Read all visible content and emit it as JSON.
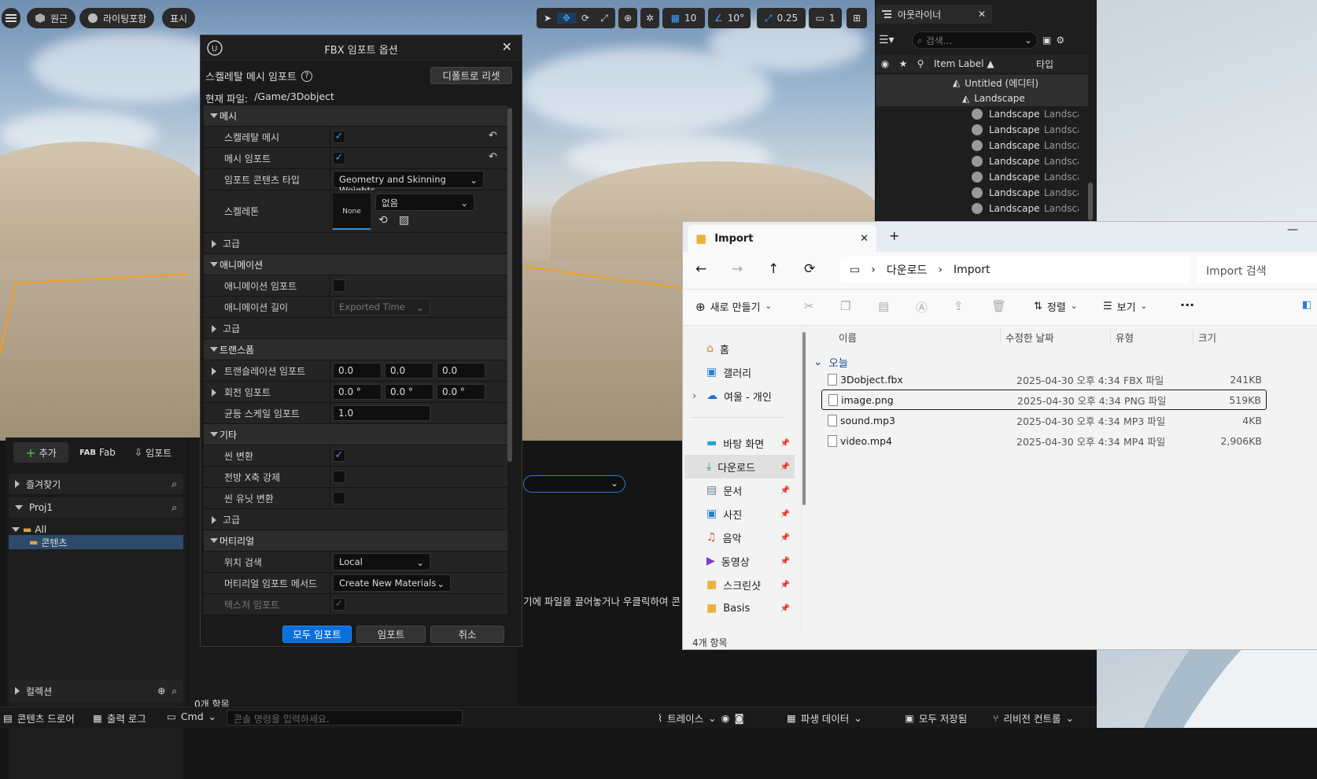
{
  "viewport": {
    "perspective_label": "원근",
    "lighting_label": "라이팅포함",
    "show_label": "표시",
    "grid_snap": "10",
    "rotation_snap": "10°",
    "scale_snap": "0.25",
    "camera_speed": "1"
  },
  "outliner": {
    "tab_title": "아웃라이너",
    "search_placeholder": "검색...",
    "col_label": "Item Label ▲",
    "col_type": "타입",
    "root": "Untitled (에디터)",
    "landscape": "Landscape",
    "children": [
      {
        "label": "Landscape",
        "type": "Landsca"
      },
      {
        "label": "Landscape",
        "type": "Landsca"
      },
      {
        "label": "Landscape",
        "type": "Landsca"
      },
      {
        "label": "Landscape",
        "type": "Landsca"
      },
      {
        "label": "Landscape",
        "type": "Landsca"
      },
      {
        "label": "Landscape",
        "type": "Landsca"
      },
      {
        "label": "Landscape",
        "type": "Landsca"
      }
    ]
  },
  "fbx": {
    "title": "FBX 임포트 옵션",
    "section_header": "스켈레탈 메시 임포트",
    "reset_button": "디폴트로 리셋",
    "current_file_label": "현재 파일:",
    "current_file_value": "/Game/3Dobject",
    "mesh_section": "메시",
    "skeletal_mesh_label": "스켈레탈 메시",
    "mesh_import_label": "메시 임포트",
    "content_type_label": "임포트 콘텐츠 타입",
    "content_type_value": "Geometry and Skinning Weights",
    "skeleton_label": "스켈레톤",
    "skeleton_thumb": "None",
    "skeleton_value": "없음",
    "advanced": "고급",
    "animation_section": "애니메이션",
    "anim_import_label": "애니메이션 임포트",
    "anim_length_label": "애니메이션 길이",
    "anim_length_value": "Exported Time",
    "transform_section": "트랜스폼",
    "translation_label": "트랜슬레이션 임포트",
    "translation": [
      "0.0",
      "0.0",
      "0.0"
    ],
    "rotation_label": "회전 임포트",
    "rotation": [
      "0.0 °",
      "0.0 °",
      "0.0 °"
    ],
    "uniform_scale_label": "균등 스케일 임포트",
    "uniform_scale": "1.0",
    "misc_section": "기타",
    "scene_convert_label": "씬 변환",
    "force_x_label": "전방 X축 강제",
    "scene_unit_label": "씬 유닛 변환",
    "material_section": "머티리얼",
    "location_search_label": "위치 검색",
    "location_search_value": "Local",
    "material_method_label": "머티리얼 임포트 메서드",
    "material_method_value": "Create New Materials",
    "texture_import_label": "텍스처 임포트",
    "import_all_button": "모두 임포트",
    "import_button": "임포트",
    "cancel_button": "취소"
  },
  "content_browser": {
    "add_button": "추가",
    "fab_button": "Fab",
    "import_button": "임포트",
    "favorites": "즐겨찾기",
    "project": "Proj1",
    "tree_all": "All",
    "tree_content": "콘텐츠",
    "collections": "컬렉션",
    "item_count": "0개 항목",
    "hint_text": "기에 파일을 끌어놓거나 우클릭하여 콘텐"
  },
  "bottom_bar": {
    "content_drawer": "콘텐츠 드로어",
    "output_log": "출력 로그",
    "cmd": "Cmd",
    "console_placeholder": "콘솔 명령을 입력하세요.",
    "trace": "트레이스",
    "derived_data": "파생 데이터",
    "save_all": "모두 저장됨",
    "revision_control": "리비전 컨트롤"
  },
  "explorer": {
    "tab_title": "Import",
    "breadcrumb": [
      "다운로드",
      "Import"
    ],
    "search_placeholder": "Import 검색",
    "new_button": "새로 만들기",
    "sort_button": "정렬",
    "view_button": "보기",
    "columns": [
      "이름",
      "수정한 날짜",
      "유형",
      "크기"
    ],
    "group_label": "오늘",
    "files": [
      {
        "name": "3Dobject.fbx",
        "date": "2025-04-30 오후 4:34",
        "type": "FBX 파일",
        "size": "241KB"
      },
      {
        "name": "image.png",
        "date": "2025-04-30 오후 4:34",
        "type": "PNG 파일",
        "size": "519KB"
      },
      {
        "name": "sound.mp3",
        "date": "2025-04-30 오후 4:34",
        "type": "MP3 파일",
        "size": "4KB"
      },
      {
        "name": "video.mp4",
        "date": "2025-04-30 오후 4:34",
        "type": "MP4 파일",
        "size": "2,906KB"
      }
    ],
    "nav": [
      "홈",
      "갤러리",
      "여울 - 개인",
      "바탕 화면",
      "다운로드",
      "문서",
      "사진",
      "음악",
      "동영상",
      "스크린샷",
      "Basis"
    ],
    "status": "4개 항목"
  }
}
